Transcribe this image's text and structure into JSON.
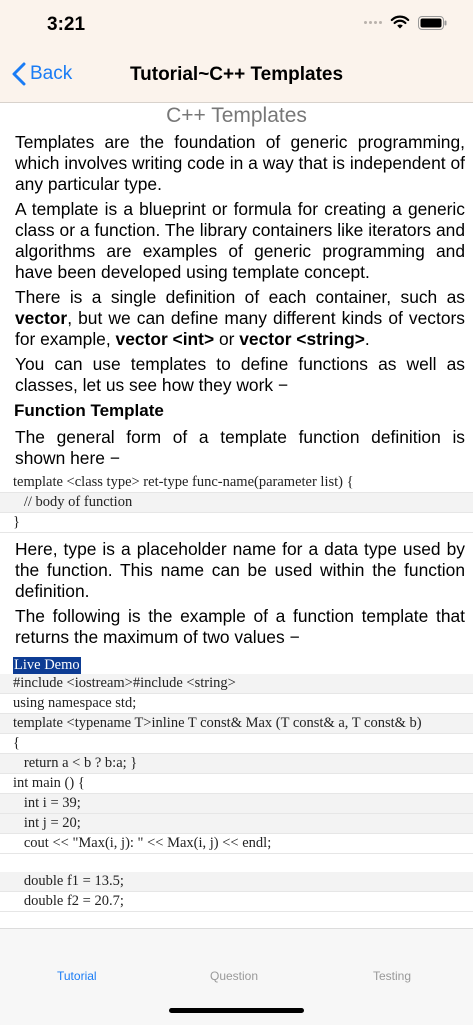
{
  "status": {
    "time": "3:21"
  },
  "nav": {
    "back_label": "Back",
    "title": "Tutorial~C++ Templates"
  },
  "content": {
    "heading": "C++ Templates",
    "paragraphs": [
      "Templates are the foundation of generic programming, which involves writing code in a way that is independent of any particular type.",
      "A template is a blueprint or formula for creating a generic class or a function. The library containers like iterators and algorithms are examples of generic programming and have been developed using template concept.",
      "You can use templates to define functions as well as classes, let us see how they work −"
    ],
    "p3": {
      "t1": "There is a single definition of each container, such as ",
      "b1": "vector",
      "t2": ", but we can define many different kinds of vectors for example, ",
      "b2": "vector <int>",
      "t3": " or ",
      "b3": "vector <string>",
      "t4": "."
    },
    "section_heading": "Function Template",
    "p_general": "The general form of a template function definition is shown here −",
    "code1": [
      "template <class type> ret-type func-name(parameter list) {",
      "   // body of function",
      "}"
    ],
    "p_here": "Here, type is a placeholder name for a data type used by the function. This name can be used within the function definition.",
    "p_following": "The following is the example of a function template that returns the maximum of two values −",
    "live_demo": "Live Demo",
    "code2": [
      "#include <iostream>#include <string>",
      "using namespace std;",
      "template <typename T>inline T const& Max (T const& a, T const& b)",
      "{",
      "   return a < b ? b:a; }",
      "int main () {",
      "   int i = 39;",
      "   int j = 20;",
      "   cout << \"Max(i, j): \" << Max(i, j) << endl;",
      "",
      "   double f1 = 13.5;",
      "   double f2 = 20.7;"
    ]
  },
  "tabs": [
    {
      "label": "Tutorial"
    },
    {
      "label": "Question"
    },
    {
      "label": "Testing"
    }
  ],
  "colors": {
    "accent": "#1a7cf5",
    "bar_background": "#fbf3ec",
    "live_demo_bg": "#0d3c94"
  }
}
